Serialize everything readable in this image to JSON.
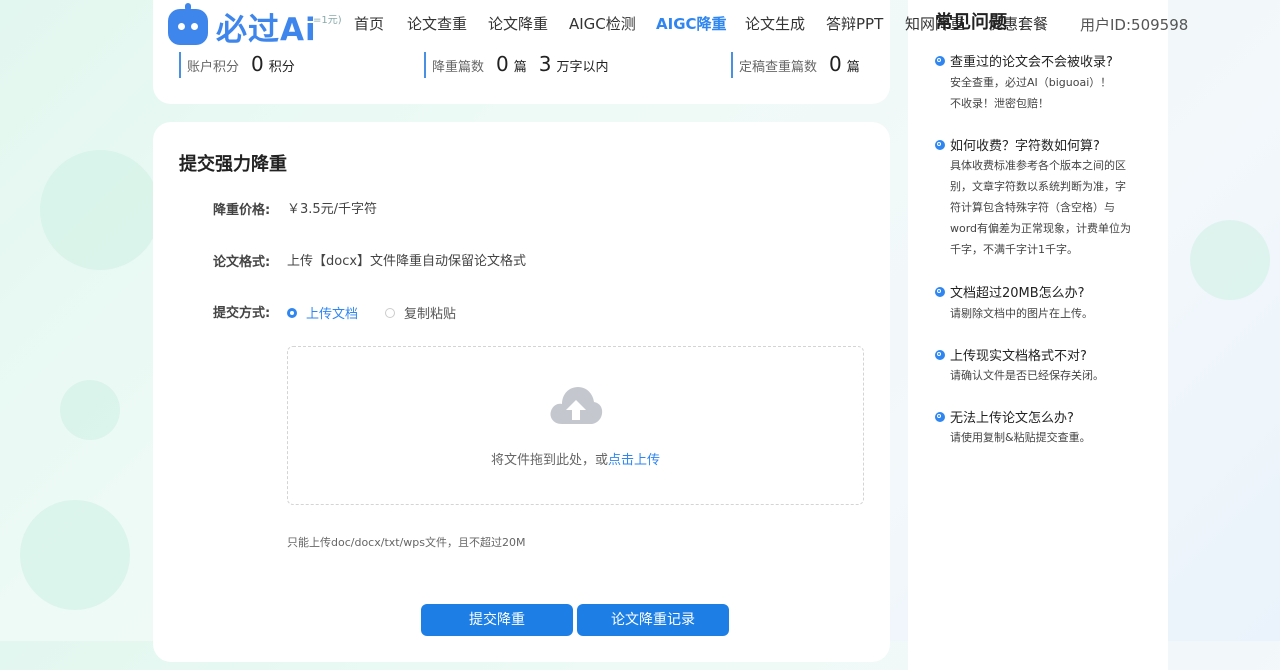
{
  "header": {
    "logo_text": "必过Ai",
    "logo_sub": "=1元)",
    "nav": [
      {
        "label": "首页",
        "active": false
      },
      {
        "label": "论文查重",
        "active": false
      },
      {
        "label": "论文降重",
        "active": false
      },
      {
        "label": "AIGC检测",
        "active": false
      },
      {
        "label": "AIGC降重",
        "active": true
      },
      {
        "label": "论文生成",
        "active": false
      },
      {
        "label": "答辩PPT",
        "active": false
      },
      {
        "label": "知网降重",
        "active": false
      },
      {
        "label": "优惠套餐",
        "active": false
      }
    ],
    "user_id": "用户ID:509598"
  },
  "stats": {
    "points_label": "账户积分",
    "points_value": "0",
    "points_unit": "积分",
    "reduce_label": "降重篇数",
    "reduce_value": "0",
    "reduce_unit": "篇",
    "reduce_words_value": "3",
    "reduce_words_unit": "万字以内",
    "final_label": "定稿查重篇数",
    "final_value": "0",
    "final_unit": "篇"
  },
  "form": {
    "title": "提交强力降重",
    "price_label": "降重价格:",
    "price_value": "￥3.5元/千字符",
    "format_label": "论文格式:",
    "format_value": "上传【docx】文件降重自动保留论文格式",
    "method_label": "提交方式:",
    "method_options": [
      "上传文档",
      "复制粘贴"
    ],
    "method_selected": "上传文档",
    "drop_text": "将文件拖到此处，或",
    "drop_link": "点击上传",
    "hint": "只能上传doc/docx/txt/wps文件，且不超过20M",
    "submit_label": "提交降重",
    "records_label": "论文降重记录"
  },
  "faq": {
    "title": "常见问题",
    "items": [
      {
        "q": "查重过的论文会不会被收录?",
        "a": "安全查重，必过AI（biguoai）！\n不收录！泄密包赔！"
      },
      {
        "q": "如何收费？字符数如何算?",
        "a": "具体收费标准参考各个版本之间的区别，文章字符数以系统判断为准，字符计算包含特殊字符（含空格）与word有偏差为正常现象，计费单位为千字，不满千字计1千字。"
      },
      {
        "q": "文档超过20MB怎么办?",
        "a": "请剔除文档中的图片在上传。"
      },
      {
        "q": "上传现实文档格式不对?",
        "a": "请确认文件是否已经保存关闭。"
      },
      {
        "q": "无法上传论文怎么办?",
        "a": "请使用复制&粘贴提交查重。"
      }
    ]
  },
  "colors": {
    "accent": "#2f86f0",
    "button": "#1d7fe6",
    "logo": "#3f86ec"
  }
}
